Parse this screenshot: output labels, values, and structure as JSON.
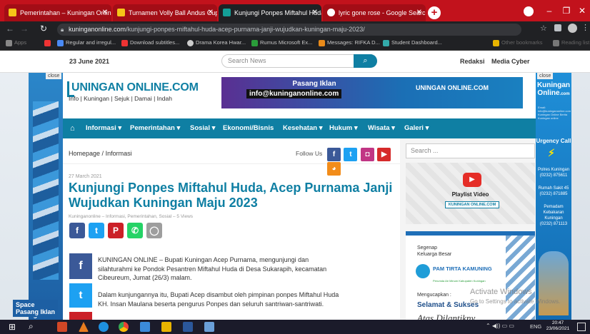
{
  "browser": {
    "tabs": [
      {
        "label": "Pemerintahan – Kuningan Online"
      },
      {
        "label": "Turnamen Volly Ball Andus Cup"
      },
      {
        "label": "Kunjungi Ponpes Miftahul Huda,"
      },
      {
        "label": "lyric gone rose - Google Search"
      }
    ],
    "url_domain": "kuninganonline.com",
    "url_path": "/kunjungi-ponpes-miftahul-huda-acep-purnama-janji-wujudkan-kuningan-maju-2023/",
    "bookmarks": [
      "Apps",
      "Regular and irregul...",
      "Download subtitles...",
      "Drama Korea Hwar...",
      "Rumus Microsoft Ex...",
      "Messages: RIFKA D...",
      "Student Dashboard...",
      "Other bookmarks",
      "Reading list"
    ]
  },
  "site": {
    "date": "23 June 2021",
    "search_placeholder": "Search News",
    "top_links": [
      "Redaksi",
      "Media Cyber"
    ],
    "logo_main": "UNINGAN ONLINE.COM",
    "logo_tagline": "Info | Kuningan | Sejuk | Damai | Indah",
    "banner_title": "Pasang Iklan",
    "banner_email": "info@kuninganonline.com",
    "nav": [
      "Informasi",
      "Pemerintahan",
      "Sosial",
      "Ekonomi/Bisnis",
      "Kesehatan",
      "Hukum",
      "Wisata",
      "Galeri"
    ]
  },
  "article": {
    "breadcrumb_home": "Homepage",
    "breadcrumb_sep": "/",
    "breadcrumb_cat": "Informasi",
    "follow_label": "Follow Us",
    "date": "27 March 2021",
    "title": "Kunjungi Ponpes Miftahul Huda, Acep Purnama Janji Wujudkan Kuningan Maju 2023",
    "meta": "Kuninganonline – Informasi, Pemerintahan, Sosial – 5 Views",
    "p1": "KUNINGAN ONLINE – Bupati Kuningan Acep Purnama, mengunjungi dan silahturahmi ke Pondok Pesantren Miftahul Huda di Desa Sukarapih, kecamatan Cibeureum, Jumat (26/3) malam.",
    "p2": "Dalam kunjungannya itu, Bupati Acep disambut oleh pimpinan ponpes Miftahul Huda KH. Insan Maulana beserta pengurus Ponpes dan seluruh santriwan-santriwati."
  },
  "sidebar": {
    "search_placeholder": "Search ...",
    "playlist_label": "Playlist Video",
    "playlist_logo": "KUNINGAN ONLINE.COM",
    "ad_line1": "Segenap",
    "ad_line2": "Keluarga Besar",
    "ad_brand": "PAM TIRTA KAMUNING",
    "ad_sub": "Perumda Air Minum Kabupaten Kuningan",
    "ad_line3": "Mengucapkan :",
    "ad_line4": "Selamat & Sukses",
    "ad_line5": "Atas Dilantikny"
  },
  "leftad": {
    "close": "close",
    "line1": "Space",
    "line2": "Pasang Iklan"
  },
  "rightad": {
    "close": "close",
    "title1": "Kuningan",
    "title2": "Online",
    "title3": ".com",
    "small": "Email: info@kuninganonline.com Kuningan Online Berita Kuningan online",
    "urgency": "Urgency Call",
    "contacts": [
      {
        "name": "Polres Kuningan",
        "phone": "(0232) 875611"
      },
      {
        "name": "Rumah Sakit 45",
        "phone": "(0232) 871885"
      },
      {
        "name": "Pemadam Kebakaran Kuningan",
        "phone": "(0232) 871113"
      }
    ]
  },
  "windows": {
    "watermark1": "Activate Windows",
    "watermark2": "Go to Settings to activate Windows.",
    "lang": "ENG",
    "time": "20:47",
    "date": "23/06/2021"
  },
  "colors": {
    "accent": "#0f7fa3",
    "chrome": "#c2121c",
    "title": "#0f7fa3"
  }
}
